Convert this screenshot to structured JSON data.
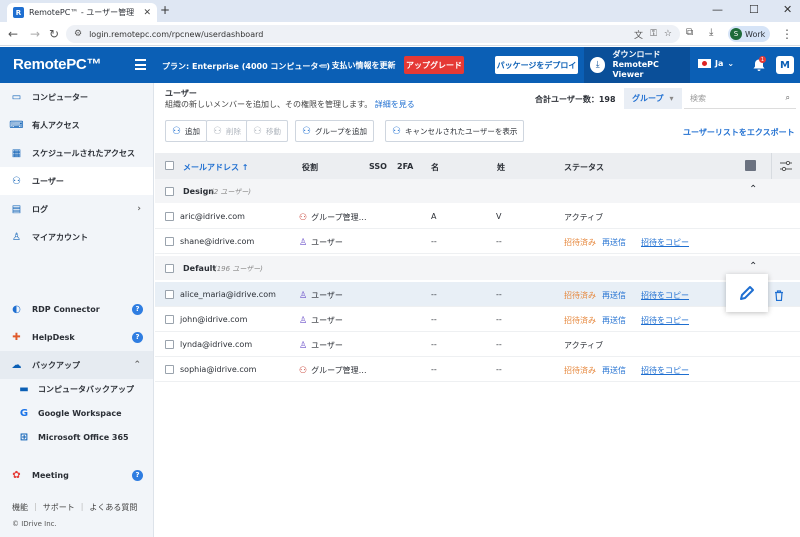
{
  "browser": {
    "tab_title": "RemotePC™ - ユーザー管理",
    "tab_favicon": "R",
    "url": "login.remotepc.com/rpcnew/userdashboard",
    "profile_initial": "S",
    "profile_label": "Work"
  },
  "header": {
    "logo": "RemotePC™",
    "plan": "プラン: Enterprise (4000 コンピューター)",
    "billing": "支払い情報を更新",
    "upgrade": "アップグレード",
    "deploy": "パッケージをデプロイ",
    "viewer_line1": "ダウンロード",
    "viewer_line2": "RemotePC Viewer",
    "language": "Ja",
    "notification_count": "1",
    "avatar": "M"
  },
  "sidebar": {
    "items": [
      {
        "label": "コンピューター",
        "icon": "monitor-icon"
      },
      {
        "label": "有人アクセス",
        "icon": "keyboard-icon"
      },
      {
        "label": "スケジュールされたアクセス",
        "icon": "calendar-icon"
      },
      {
        "label": "ユーザー",
        "icon": "users-icon"
      },
      {
        "label": "ログ",
        "icon": "log-icon"
      },
      {
        "label": "マイアカウント",
        "icon": "account-icon"
      }
    ],
    "services": [
      {
        "label": "RDP Connector"
      },
      {
        "label": "HelpDesk"
      },
      {
        "label": "バックアップ"
      }
    ],
    "backup_sub": [
      {
        "label": "コンピュータバックアップ"
      },
      {
        "label": "Google Workspace"
      },
      {
        "label": "Microsoft Office 365"
      }
    ],
    "meeting": "Meeting",
    "footer": [
      "機能",
      "サポート",
      "よくある質問"
    ],
    "copyright": "© IDrive Inc."
  },
  "page": {
    "breadcrumb": "ユーザー",
    "description": "組織の新しいメンバーを追加し、その権限を管理します。",
    "details_link": "詳細を見る",
    "total_users": "合計ユーザー数：198",
    "group_select": "グループ",
    "search_placeholder": "検索",
    "export_link": "ユーザーリストをエクスポート"
  },
  "toolbar": {
    "add": "追加",
    "delete": "削除",
    "move": "移動",
    "add_group": "グループを追加",
    "show_canceled": "キャンセルされたユーザーを表示"
  },
  "table": {
    "headers": {
      "email": "メールアドレス ↑",
      "role": "役割",
      "sso": "SSO",
      "twofa": "2FA",
      "first": "名",
      "last": "姓",
      "status": "ステータス"
    },
    "groups": [
      {
        "name": "Design",
        "count": "(2 ユーザー)",
        "rows": [
          {
            "email": "aric@idrive.com",
            "role": "グループ管理…",
            "admin": true,
            "first": "A",
            "last": "V",
            "status": "アクティブ",
            "resend": "",
            "copy": ""
          },
          {
            "email": "shane@idrive.com",
            "role": "ユーザー",
            "admin": false,
            "first": "--",
            "last": "--",
            "status": "招待済み",
            "resend": "再送信",
            "copy": "招待をコピー"
          }
        ]
      },
      {
        "name": "Default",
        "count": "(196 ユーザー)",
        "rows": [
          {
            "email": "alice_maria@idrive.com",
            "role": "ユーザー",
            "admin": false,
            "first": "--",
            "last": "--",
            "status": "招待済み",
            "resend": "再送信",
            "copy": "招待をコピー"
          },
          {
            "email": "john@idrive.com",
            "role": "ユーザー",
            "admin": false,
            "first": "--",
            "last": "--",
            "status": "招待済み",
            "resend": "再送信",
            "copy": "招待をコピー"
          },
          {
            "email": "lynda@idrive.com",
            "role": "ユーザー",
            "admin": false,
            "first": "--",
            "last": "--",
            "status": "アクティブ",
            "resend": "",
            "copy": ""
          },
          {
            "email": "sophia@idrive.com",
            "role": "グループ管理…",
            "admin": true,
            "first": "--",
            "last": "--",
            "status": "招待済み",
            "resend": "再送信",
            "copy": "招待をコピー"
          }
        ]
      }
    ]
  },
  "colors": {
    "brand": "#0b5fb5",
    "upgrade": "#e53935",
    "invited": "#e6863a",
    "link": "#1f6fd1"
  }
}
